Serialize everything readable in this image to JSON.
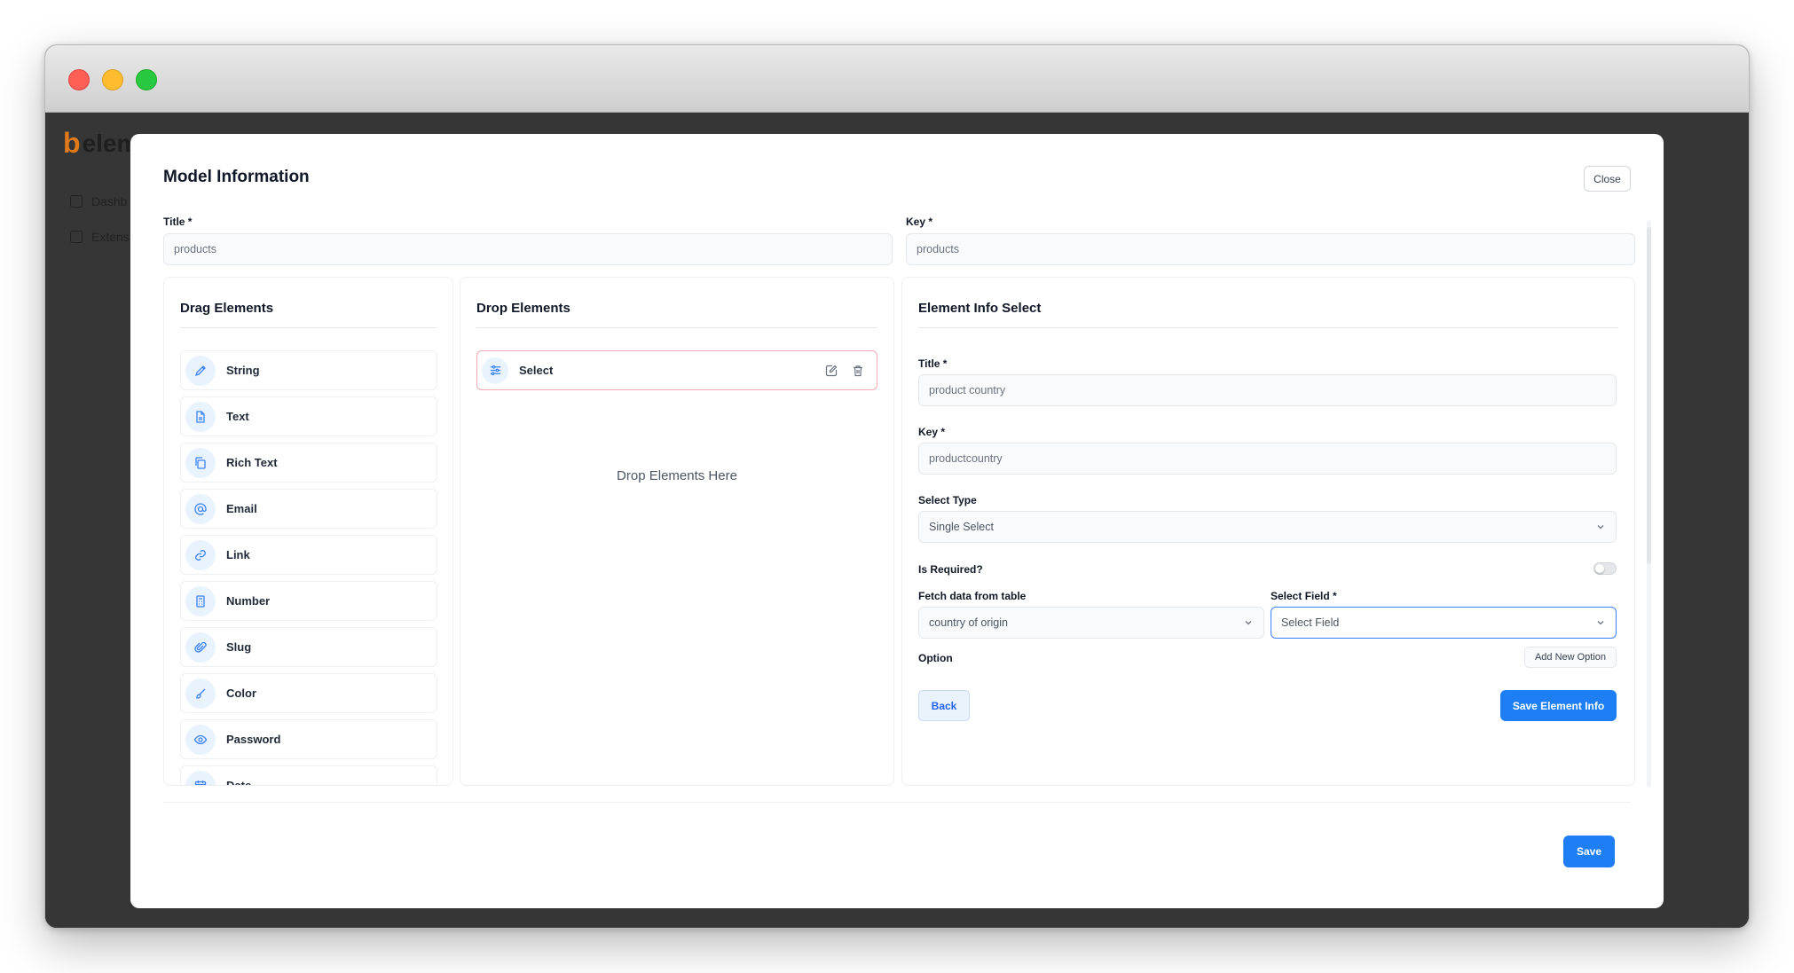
{
  "app": {
    "logo_text": "elem",
    "nav": [
      "Dashb",
      "Extens"
    ]
  },
  "modal": {
    "title": "Model Information",
    "close_label": "Close",
    "title_field": {
      "label": "Title *",
      "value": "products"
    },
    "key_field": {
      "label": "Key *",
      "value": "products"
    },
    "save_label": "Save"
  },
  "drag_panel": {
    "title": "Drag Elements",
    "items": [
      {
        "label": "String",
        "icon": "pencil-icon"
      },
      {
        "label": "Text",
        "icon": "document-icon"
      },
      {
        "label": "Rich Text",
        "icon": "copy-icon"
      },
      {
        "label": "Email",
        "icon": "at-icon"
      },
      {
        "label": "Link",
        "icon": "link-icon"
      },
      {
        "label": "Number",
        "icon": "calculator-icon"
      },
      {
        "label": "Slug",
        "icon": "paperclip-icon"
      },
      {
        "label": "Color",
        "icon": "brush-icon"
      },
      {
        "label": "Password",
        "icon": "eye-icon"
      },
      {
        "label": "Date",
        "icon": "calendar-icon"
      }
    ]
  },
  "drop_panel": {
    "title": "Drop Elements",
    "dropped": [
      {
        "label": "Select",
        "icon": "sliders-icon"
      }
    ],
    "hint": "Drop Elements Here"
  },
  "info_panel": {
    "title": "Element Info Select",
    "title_field": {
      "label": "Title *",
      "value": "product country"
    },
    "key_field": {
      "label": "Key *",
      "value": "productcountry"
    },
    "select_type": {
      "label": "Select Type",
      "value": "Single Select"
    },
    "is_required": {
      "label": "Is Required?",
      "value": false
    },
    "fetch_table": {
      "label": "Fetch data from table",
      "value": "country of origin"
    },
    "select_field": {
      "label": "Select Field *",
      "value": "Select Field"
    },
    "option_label": "Option",
    "add_option_label": "Add New Option",
    "back_label": "Back",
    "save_label": "Save Element Info"
  },
  "colors": {
    "primary": "#1d7ff3",
    "icon_bg": "#e9f3fd",
    "icon_stroke": "#3b82f6",
    "drop_border": "#f3a9b2"
  }
}
